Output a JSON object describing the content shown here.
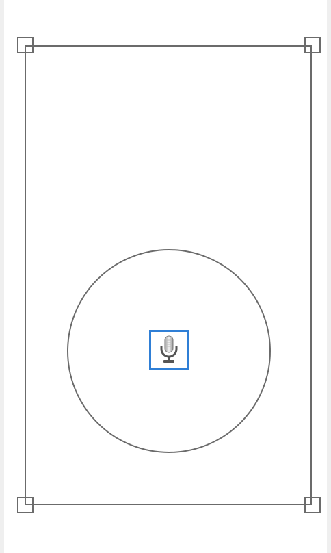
{
  "canvas": {
    "background": "#ffffff",
    "edge_color": "#efefef",
    "stroke_color": "#6b6b6b"
  },
  "selection_frame": {
    "handles": [
      "top-left",
      "top-right",
      "bottom-left",
      "bottom-right"
    ]
  },
  "microphone_button": {
    "icon": "microphone-icon",
    "focus_color": "#2f7fd6"
  }
}
